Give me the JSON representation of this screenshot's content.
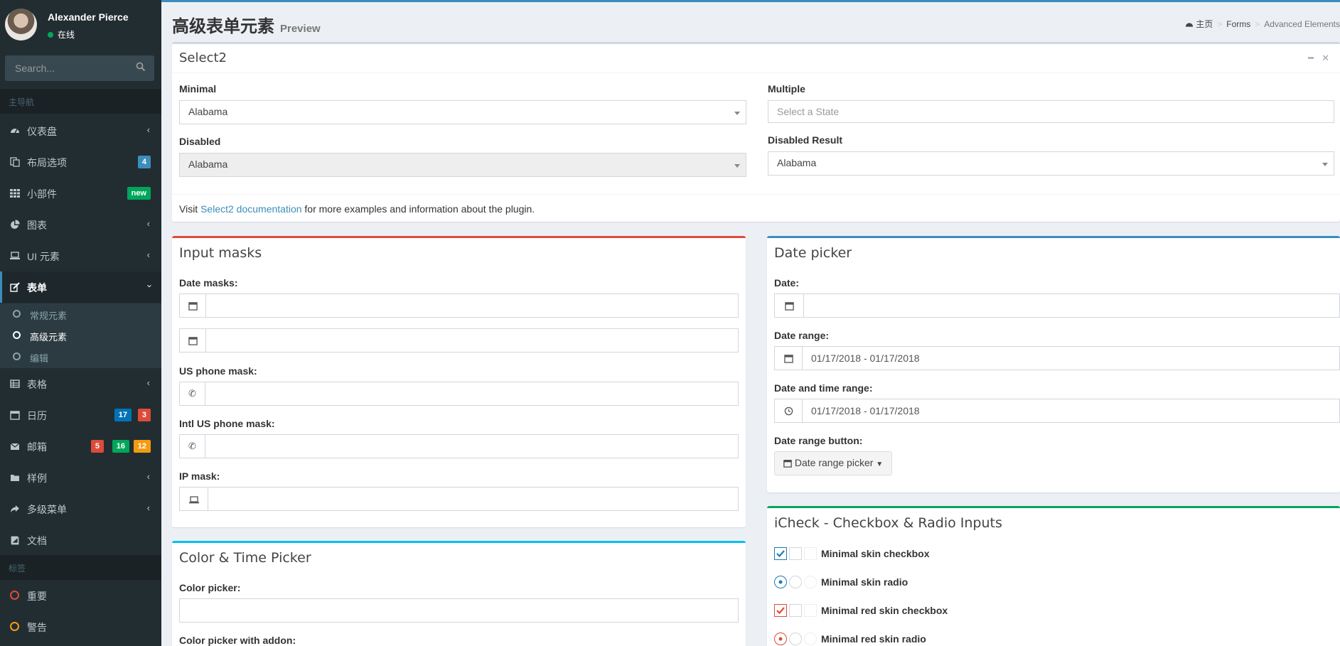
{
  "user": {
    "name": "Alexander Pierce",
    "status": "在线"
  },
  "search": {
    "placeholder": "Search..."
  },
  "nav": {
    "main_header": "主导航",
    "items": [
      {
        "label": "仪表盘",
        "icon": "dashboard-icon"
      },
      {
        "label": "布局选项",
        "icon": "files-icon",
        "badge": "4"
      },
      {
        "label": "小部件",
        "icon": "th-icon",
        "badge": "new"
      },
      {
        "label": "图表",
        "icon": "pie-chart-icon"
      },
      {
        "label": "UI 元素",
        "icon": "laptop-icon"
      },
      {
        "label": "表单",
        "icon": "edit-icon"
      },
      {
        "label": "表格",
        "icon": "table-icon"
      },
      {
        "label": "日历",
        "icon": "calendar-icon",
        "badges": [
          "17",
          "3"
        ]
      },
      {
        "label": "邮箱",
        "icon": "envelope-icon",
        "badges": [
          "5",
          "16",
          "12"
        ]
      },
      {
        "label": "样例",
        "icon": "folder-icon"
      },
      {
        "label": "多级菜单",
        "icon": "share-icon"
      },
      {
        "label": "文档",
        "icon": "book-icon"
      }
    ],
    "sub_items": [
      "常规元素",
      "高级元素",
      "编辑"
    ],
    "labels_header": "标签",
    "labels": [
      "重要",
      "警告"
    ]
  },
  "header": {
    "title": "高级表单元素",
    "subtitle": "Preview",
    "breadcrumb": [
      "主页",
      "Forms",
      "Advanced Elements"
    ]
  },
  "select2": {
    "title": "Select2",
    "minimal_label": "Minimal",
    "minimal_value": "Alabama",
    "multiple_label": "Multiple",
    "multiple_placeholder": "Select a State",
    "disabled_label": "Disabled",
    "disabled_value": "Alabama",
    "disabled_result_label": "Disabled Result",
    "disabled_result_value": "Alabama",
    "footer_prefix": "Visit ",
    "footer_link": "Select2 documentation",
    "footer_suffix": " for more examples and information about the plugin."
  },
  "input_masks": {
    "title": "Input masks",
    "date_masks_label": "Date masks:",
    "us_phone_label": "US phone mask:",
    "intl_phone_label": "Intl US phone mask:",
    "ip_label": "IP mask:"
  },
  "date_picker": {
    "title": "Date picker",
    "date_label": "Date:",
    "range_label": "Date range:",
    "range_value": "01/17/2018 - 01/17/2018",
    "time_range_label": "Date and time range:",
    "time_range_value": "01/17/2018 - 01/17/2018",
    "button_label": "Date range button:",
    "button_text": "Date range picker"
  },
  "color_time": {
    "title": "Color & Time Picker",
    "color_label": "Color picker:",
    "addon_label": "Color picker with addon:"
  },
  "icheck": {
    "title": "iCheck - Checkbox & Radio Inputs",
    "rows": [
      "Minimal skin checkbox",
      "Minimal skin radio",
      "Minimal red skin checkbox",
      "Minimal red skin radio"
    ]
  },
  "colors": {
    "sidebar_bg": "#222d32",
    "primary": "#3c8dbc",
    "danger": "#dd4b39",
    "success": "#00a65a",
    "warning": "#f39c12",
    "info": "#00c0ef"
  }
}
